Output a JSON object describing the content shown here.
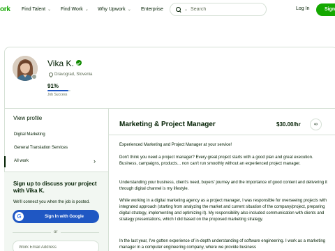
{
  "nav": {
    "logo": "ork",
    "find_talent": "Find Talent",
    "find_work": "Find Work",
    "why_upwork": "Why Upwork",
    "enterprise": "Enterprise",
    "search_placeholder": "Search",
    "login": "Log In",
    "signup": "Sign"
  },
  "profile": {
    "name": "Vika K.",
    "location": "Dravograd, Slovenia",
    "job_success_pct": "91%",
    "job_success_value": 0.91,
    "job_success_label": "Job Success"
  },
  "sidebar": {
    "view_profile": "View profile",
    "items": [
      {
        "label": "Digital Marketing"
      },
      {
        "label": "General Translation Services"
      },
      {
        "label": "All work"
      }
    ],
    "signup_title": "Sign up to discuss your project with Vika K.",
    "signup_text": "We'll connect you when the job is posted.",
    "google_button": "Sign In with Google",
    "or": "or",
    "email_placeholder": "Work Email Address"
  },
  "main": {
    "title": "Marketing & Project Manager",
    "rate": "$30.00/hr",
    "paragraphs": [
      "Experienced Marketing and Project Manager at your service!",
      "Don't think you need a project manager? Every great project starts with a good plan and great execution. Business, campaigns, products... non can't run smoothly without an experienced project manager.",
      "Understanding your business, client's need, buyers' journey and the importance of good content and delivering it through digital channel is my lifestyle.",
      "While working in a digital marketing agency as a project manager, I was responsible for overseeing projects with integrated approach (starting from analyzing the market and current situation of the company/project, preparing digital strategy, implementing and optimizing it). My responsibility also included communication with clients and strategy presentations, which I did based on the proposed marketing strategy.",
      "In the last year, I've gotten experience of in-depth understanding of software engineering. I work as a marketing manager in a computer engineering company, where we provide business"
    ]
  },
  "colors": {
    "brand_green": "#14a800",
    "google_blue": "#1f57c3",
    "text": "#001e00",
    "muted": "#5e6d55"
  }
}
